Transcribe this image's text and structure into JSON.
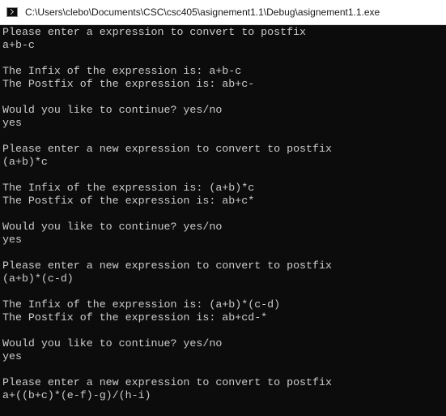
{
  "window": {
    "title": "C:\\Users\\clebo\\Documents\\CSC\\csc405\\asignement1.1\\Debug\\asignement1.1.exe",
    "icon": "console-app-icon"
  },
  "console": {
    "lines": [
      "Please enter a expression to convert to postfix",
      "a+b-c",
      "",
      "The Infix of the expression is: a+b-c",
      "The Postfix of the expression is: ab+c-",
      "",
      "Would you like to continue? yes/no",
      "yes",
      "",
      "Please enter a new expression to convert to postfix",
      "(a+b)*c",
      "",
      "The Infix of the expression is: (a+b)*c",
      "The Postfix of the expression is: ab+c*",
      "",
      "Would you like to continue? yes/no",
      "yes",
      "",
      "Please enter a new expression to convert to postfix",
      "(a+b)*(c-d)",
      "",
      "The Infix of the expression is: (a+b)*(c-d)",
      "The Postfix of the expression is: ab+cd-*",
      "",
      "Would you like to continue? yes/no",
      "yes",
      "",
      "Please enter a new expression to convert to postfix",
      "a+((b+c)*(e-f)-g)/(h-i)"
    ]
  }
}
